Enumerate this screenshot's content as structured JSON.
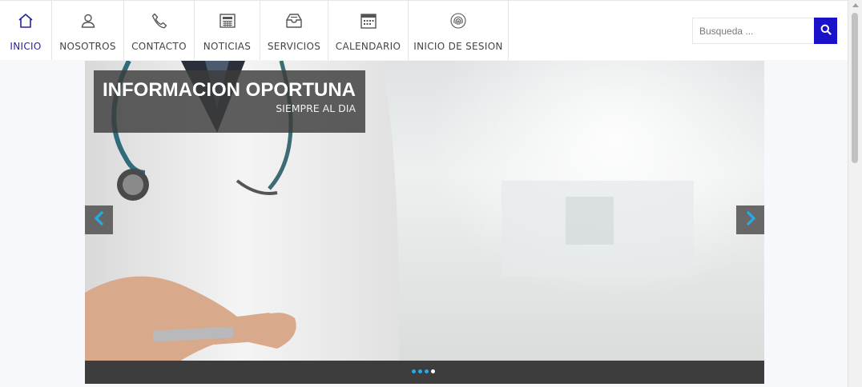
{
  "nav": {
    "items": [
      {
        "label": "INICIO",
        "icon": "home-icon",
        "active": true
      },
      {
        "label": "NOSOTROS",
        "icon": "user-icon",
        "active": false
      },
      {
        "label": "CONTACTO",
        "icon": "phone-icon",
        "active": false
      },
      {
        "label": "NOTICIAS",
        "icon": "newspaper-icon",
        "active": false
      },
      {
        "label": "SERVICIOS",
        "icon": "inbox-icon",
        "active": false
      },
      {
        "label": "CALENDARIO",
        "icon": "calendar-icon",
        "active": false
      },
      {
        "label": "INICIO DE SESION",
        "icon": "fingerprint-icon",
        "active": false
      }
    ]
  },
  "search": {
    "placeholder": "Busqueda ...",
    "button_icon": "search-icon"
  },
  "slider": {
    "title": "INFORMACION OPORTUNA",
    "subtitle": "SIEMPRE AL DIA",
    "prev_icon": "chevron-left-icon",
    "next_icon": "chevron-right-icon",
    "slide_count": 4,
    "active_slide": 4
  },
  "colors": {
    "accent": "#1a12c9",
    "active_nav": "#2323a8",
    "arrow": "#2aa9e8",
    "dots_bar": "#3d3d3d"
  }
}
